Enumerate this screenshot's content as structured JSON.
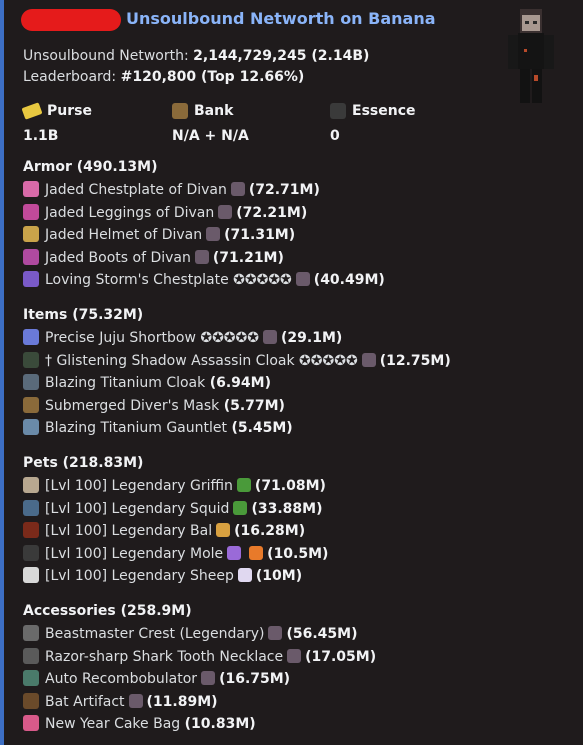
{
  "title": "Unsoulbound Networth on Banana",
  "networth_label": "Unsoulbound Networth: ",
  "networth_value": "2,144,729,245 (2.14B)",
  "leaderboard_label": "Leaderboard: ",
  "leaderboard_value": "#120,800 (Top 12.66%)",
  "purse": {
    "label": "Purse",
    "value": "1.1B"
  },
  "bank": {
    "label": "Bank",
    "value": "N/A + N/A"
  },
  "essence": {
    "label": "Essence",
    "value": "0"
  },
  "colors": {
    "accent": "#3d6fc4",
    "title": "#8ab4f8",
    "redaction": "#e51b1b"
  },
  "sections": [
    {
      "title": "Armor (490.13M)",
      "items": [
        {
          "name": "Jaded Chestplate of Divan",
          "value": "(72.71M)",
          "icon": "chestplate-icon",
          "color": "#d86aa8",
          "extra": "gem"
        },
        {
          "name": "Jaded Leggings of Divan",
          "value": "(72.21M)",
          "icon": "leggings-icon",
          "color": "#c14a9a",
          "extra": "gem"
        },
        {
          "name": "Jaded Helmet of Divan",
          "value": "(71.31M)",
          "icon": "helmet-icon",
          "color": "#c9a34a",
          "extra": "gem"
        },
        {
          "name": "Jaded Boots of Divan",
          "value": "(71.21M)",
          "icon": "boots-icon",
          "color": "#b04aa0",
          "extra": "gem"
        },
        {
          "name": "Loving Storm's Chestplate ✪✪✪✪✪",
          "value": "(40.49M)",
          "icon": "storm-chestplate-icon",
          "color": "#7a5ac8",
          "extra": "gem"
        }
      ]
    },
    {
      "title": "Items (75.32M)",
      "items": [
        {
          "name": "Precise Juju Shortbow ✪✪✪✪✪",
          "value": "(29.1M)",
          "icon": "bow-icon",
          "color": "#6a7ad8",
          "extra": "gem"
        },
        {
          "name": "† Glistening Shadow Assassin Cloak ✪✪✪✪✪",
          "value": "(12.75M)",
          "icon": "cloak-icon",
          "color": "#3a4a3a",
          "extra": "gem"
        },
        {
          "name": "Blazing Titanium Cloak",
          "value": "(6.94M)",
          "icon": "titanium-cloak-icon",
          "color": "#5a6a7a",
          "extra": ""
        },
        {
          "name": "Submerged Diver's Mask",
          "value": "(5.77M)",
          "icon": "mask-icon",
          "color": "#8a6a3a",
          "extra": ""
        },
        {
          "name": "Blazing Titanium Gauntlet",
          "value": "(5.45M)",
          "icon": "gauntlet-icon",
          "color": "#6a8aa8",
          "extra": ""
        }
      ]
    },
    {
      "title": "Pets (218.83M)",
      "items": [
        {
          "name": "[Lvl 100] Legendary Griffin",
          "value": "(71.08M)",
          "icon": "griffin-icon",
          "color": "#b8a890",
          "extra": "leaf"
        },
        {
          "name": "[Lvl 100] Legendary Squid",
          "value": "(33.88M)",
          "icon": "squid-icon",
          "color": "#4a6a8a",
          "extra": "leaf"
        },
        {
          "name": "[Lvl 100] Legendary Bal",
          "value": "(16.28M)",
          "icon": "bal-icon",
          "color": "#7a2a1a",
          "extra": "cookie"
        },
        {
          "name": "[Lvl 100] Legendary Mole",
          "value": "(10.5M)",
          "icon": "mole-icon",
          "color": "#3a3a3a",
          "extra": "pick-carrot"
        },
        {
          "name": "[Lvl 100] Legendary Sheep",
          "value": "(10M)",
          "icon": "sheep-icon",
          "color": "#d8d8d8",
          "extra": "cube"
        }
      ]
    },
    {
      "title": "Accessories (258.9M)",
      "items": [
        {
          "name": "Beastmaster Crest (Legendary)",
          "value": "(56.45M)",
          "icon": "crest-icon",
          "color": "#6a6a6a",
          "extra": "gem"
        },
        {
          "name": "Razor-sharp Shark Tooth Necklace",
          "value": "(17.05M)",
          "icon": "necklace-icon",
          "color": "#5a5a5a",
          "extra": "gem"
        },
        {
          "name": "Auto Recombobulator",
          "value": "(16.75M)",
          "icon": "recombobulator-icon",
          "color": "#4a7a6a",
          "extra": "gem"
        },
        {
          "name": "Bat Artifact",
          "value": "(11.89M)",
          "icon": "bat-icon",
          "color": "#6a4a2a",
          "extra": "gem"
        },
        {
          "name": "New Year Cake Bag",
          "value": "(10.83M)",
          "icon": "cake-bag-icon",
          "color": "#d85a8a",
          "extra": ""
        }
      ]
    }
  ]
}
